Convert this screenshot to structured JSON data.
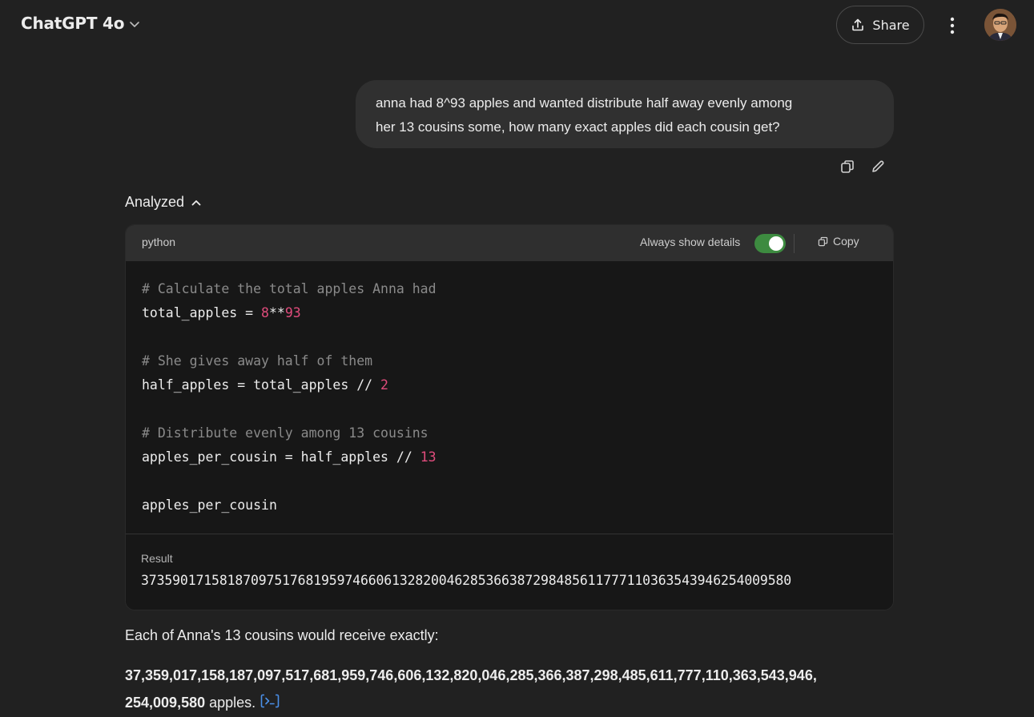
{
  "header": {
    "model_title": "ChatGPT 4o",
    "share_label": "Share"
  },
  "user_message": {
    "line1": "anna had 8^93 apples and wanted distribute half away evenly among",
    "line2": "her 13 cousins some, how many exact apples did each cousin get?"
  },
  "analysis": {
    "status_label": "Analyzed",
    "language": "python",
    "details_label": "Always show details",
    "details_enabled": true,
    "copy_label": "Copy",
    "code": {
      "c1": "# Calculate the total apples Anna had",
      "l2a": "total_apples = ",
      "l2n1": "8",
      "l2op": "**",
      "l2n2": "93",
      "c3": "# She gives away half of them",
      "l4a": "half_apples = total_apples // ",
      "l4n": "2",
      "c5": "# Distribute evenly among 13 cousins",
      "l6a": "apples_per_cousin = half_apples // ",
      "l6n": "13",
      "l7": "apples_per_cousin"
    },
    "result_label": "Result",
    "result_value": "37359017158187097517681959746606132820046285366387298485611777110363543946254009580"
  },
  "answer": {
    "intro": "Each of Anna's 13 cousins would receive exactly:",
    "number_part1": "37,359,017,158,187,097,517,681,959,746,606,132,820,046,285,366,387,298,485,611,777,110,363,543,946,",
    "number_part2": "254,009,580",
    "suffix": " apples."
  },
  "colors": {
    "background": "#212121",
    "toggle_on": "#3d8b40",
    "number_literal": "#e04c7c",
    "comment": "#8a8a8a",
    "source_icon": "#4a8fe7"
  }
}
